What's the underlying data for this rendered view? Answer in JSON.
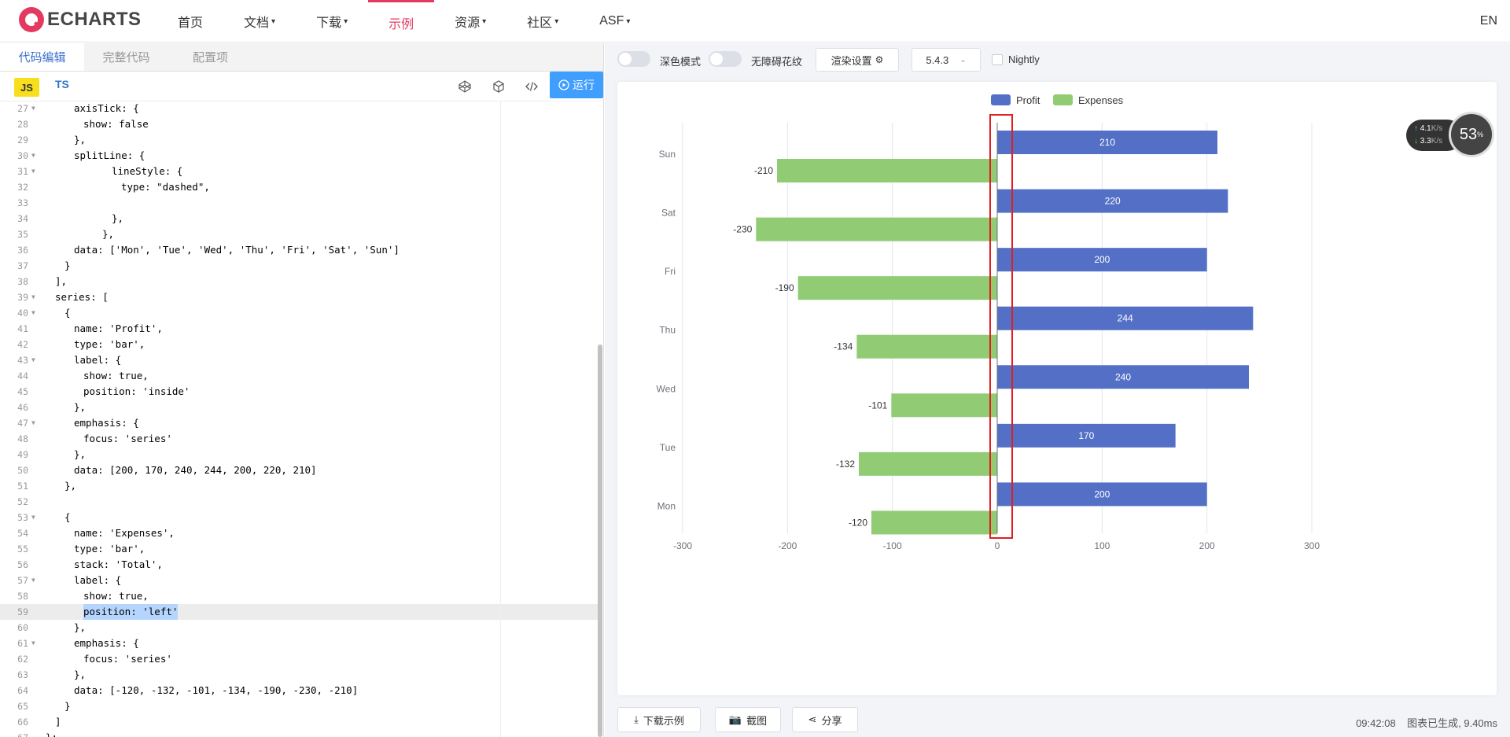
{
  "nav": {
    "logo_text": "ECHARTS",
    "items": [
      {
        "label": "首页",
        "dropdown": false,
        "active": false
      },
      {
        "label": "文档",
        "dropdown": true,
        "active": false
      },
      {
        "label": "下载",
        "dropdown": true,
        "active": false
      },
      {
        "label": "示例",
        "dropdown": false,
        "active": true
      },
      {
        "label": "资源",
        "dropdown": true,
        "active": false
      },
      {
        "label": "社区",
        "dropdown": true,
        "active": false
      },
      {
        "label": "ASF",
        "dropdown": true,
        "active": false
      }
    ],
    "lang": "EN",
    "accent": "#e43961"
  },
  "editor": {
    "tabs": [
      "代码编辑",
      "完整代码",
      "配置项"
    ],
    "lang_js": "JS",
    "lang_ts": "TS",
    "run_label": "运行",
    "lines": [
      {
        "n": "27",
        "fold": true,
        "indent": 2,
        "text": "axisTick: {"
      },
      {
        "n": "28",
        "fold": false,
        "indent": 3,
        "text": "show: false"
      },
      {
        "n": "29",
        "fold": false,
        "indent": 2,
        "text": "},"
      },
      {
        "n": "30",
        "fold": true,
        "indent": 2,
        "text": "splitLine: {"
      },
      {
        "n": "31",
        "fold": true,
        "indent": 6,
        "text": "lineStyle: {"
      },
      {
        "n": "32",
        "fold": false,
        "indent": 7,
        "text": "type: \"dashed\","
      },
      {
        "n": "33",
        "fold": false,
        "indent": 7,
        "text": ""
      },
      {
        "n": "34",
        "fold": false,
        "indent": 6,
        "text": "},"
      },
      {
        "n": "35",
        "fold": false,
        "indent": 5,
        "text": "},"
      },
      {
        "n": "36",
        "fold": false,
        "indent": 2,
        "text": "data: ['Mon', 'Tue', 'Wed', 'Thu', 'Fri', 'Sat', 'Sun']"
      },
      {
        "n": "37",
        "fold": false,
        "indent": 1,
        "text": "}"
      },
      {
        "n": "38",
        "fold": false,
        "indent": 0,
        "text": "],"
      },
      {
        "n": "39",
        "fold": true,
        "indent": 0,
        "text": "series: ["
      },
      {
        "n": "40",
        "fold": true,
        "indent": 1,
        "text": "{"
      },
      {
        "n": "41",
        "fold": false,
        "indent": 2,
        "text": "name: 'Profit',"
      },
      {
        "n": "42",
        "fold": false,
        "indent": 2,
        "text": "type: 'bar',"
      },
      {
        "n": "43",
        "fold": true,
        "indent": 2,
        "text": "label: {"
      },
      {
        "n": "44",
        "fold": false,
        "indent": 3,
        "text": "show: true,"
      },
      {
        "n": "45",
        "fold": false,
        "indent": 3,
        "text": "position: 'inside'"
      },
      {
        "n": "46",
        "fold": false,
        "indent": 2,
        "text": "},"
      },
      {
        "n": "47",
        "fold": true,
        "indent": 2,
        "text": "emphasis: {"
      },
      {
        "n": "48",
        "fold": false,
        "indent": 3,
        "text": "focus: 'series'"
      },
      {
        "n": "49",
        "fold": false,
        "indent": 2,
        "text": "},"
      },
      {
        "n": "50",
        "fold": false,
        "indent": 2,
        "text": "data: [200, 170, 240, 244, 200, 220, 210]"
      },
      {
        "n": "51",
        "fold": false,
        "indent": 1,
        "text": "},"
      },
      {
        "n": "52",
        "fold": false,
        "indent": 0,
        "text": ""
      },
      {
        "n": "53",
        "fold": true,
        "indent": 1,
        "text": "{"
      },
      {
        "n": "54",
        "fold": false,
        "indent": 2,
        "text": "name: 'Expenses',"
      },
      {
        "n": "55",
        "fold": false,
        "indent": 2,
        "text": "type: 'bar',"
      },
      {
        "n": "56",
        "fold": false,
        "indent": 2,
        "text": "stack: 'Total',"
      },
      {
        "n": "57",
        "fold": true,
        "indent": 2,
        "text": "label: {"
      },
      {
        "n": "58",
        "fold": false,
        "indent": 3,
        "text": "show: true,"
      },
      {
        "n": "59",
        "fold": false,
        "indent": 3,
        "text": "position: 'left'",
        "highlight": true
      },
      {
        "n": "60",
        "fold": false,
        "indent": 2,
        "text": "},"
      },
      {
        "n": "61",
        "fold": true,
        "indent": 2,
        "text": "emphasis: {"
      },
      {
        "n": "62",
        "fold": false,
        "indent": 3,
        "text": "focus: 'series'"
      },
      {
        "n": "63",
        "fold": false,
        "indent": 2,
        "text": "},"
      },
      {
        "n": "64",
        "fold": false,
        "indent": 2,
        "text": "data: [-120, -132, -101, -134, -190, -230, -210]"
      },
      {
        "n": "65",
        "fold": false,
        "indent": 1,
        "text": "}"
      },
      {
        "n": "66",
        "fold": false,
        "indent": 0,
        "text": "]"
      },
      {
        "n": "67",
        "fold": false,
        "indent": -1,
        "text": "};"
      }
    ]
  },
  "controls": {
    "dark_mode": "深色模式",
    "decal": "无障碍花纹",
    "render_settings": "渲染设置",
    "version": "5.4.3",
    "nightly": "Nightly"
  },
  "perf": {
    "up": "4.1",
    "down": "3.3",
    "unit": "K/s",
    "percent": "53"
  },
  "bottom": {
    "download": "下载示例",
    "screenshot": "截图",
    "share": "分享",
    "time": "09:42:08",
    "status": "图表已生成, 9.40ms"
  },
  "chart_data": {
    "type": "bar",
    "orientation": "horizontal",
    "categories": [
      "Mon",
      "Tue",
      "Wed",
      "Thu",
      "Fri",
      "Sat",
      "Sun"
    ],
    "series": [
      {
        "name": "Profit",
        "values": [
          200,
          170,
          240,
          244,
          200,
          220,
          210
        ],
        "color": "#5470c6",
        "label_position": "inside"
      },
      {
        "name": "Expenses",
        "values": [
          -120,
          -132,
          -101,
          -134,
          -190,
          -230,
          -210
        ],
        "color": "#91cc75",
        "label_position": "left"
      }
    ],
    "xlim": [
      -300,
      300
    ],
    "xticks": [
      -300,
      -200,
      -100,
      0,
      100,
      200,
      300
    ],
    "legend": "top-center",
    "grid": true,
    "annotation_color": "#e02020"
  }
}
